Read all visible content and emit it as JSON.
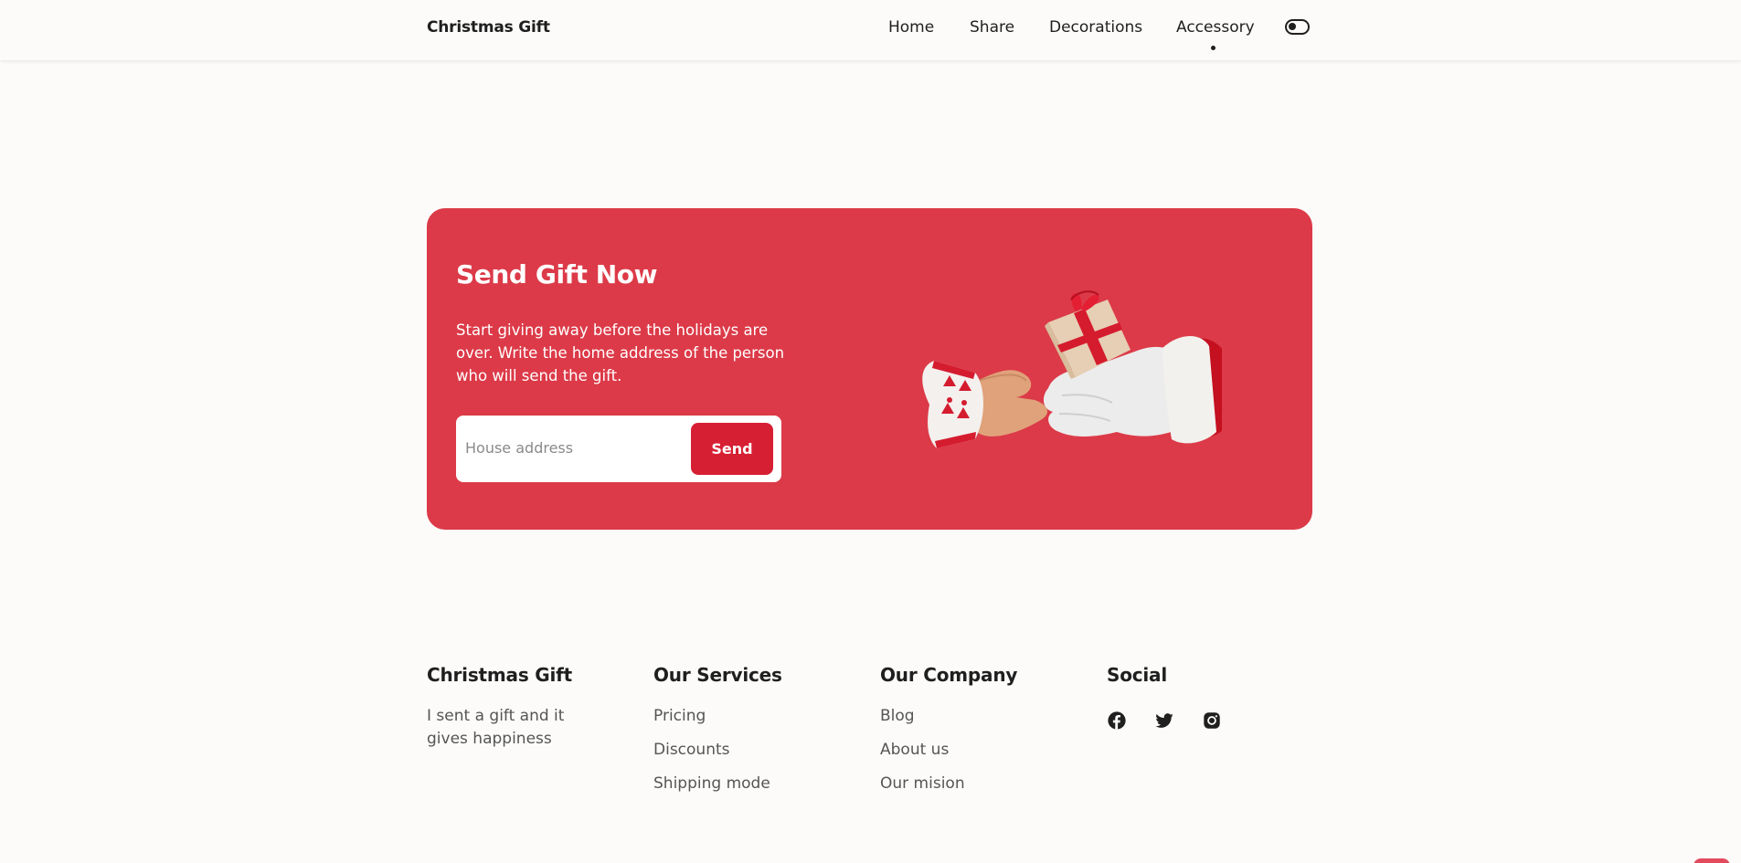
{
  "header": {
    "logo": "Christmas Gift",
    "nav": {
      "home": "Home",
      "share": "Share",
      "decorations": "Decorations",
      "accessory": "Accessory"
    },
    "active_item": "Accessory",
    "theme_toggle_icon": "toggle-icon"
  },
  "banner": {
    "title": "Send Gift Now",
    "text": "Start giving away before the holidays are over. Write the home address of the person who will send the gift.",
    "input_placeholder": "House address",
    "input_value": "",
    "button_label": "Send",
    "illustration_icon": "gift-hands-illustration",
    "background_color": "#dc3a48",
    "button_color": "#d71f33"
  },
  "footer": {
    "brand": {
      "title": "Christmas Gift",
      "description": "I sent a gift and it gives happiness"
    },
    "services": {
      "title": "Our Services",
      "links": [
        "Pricing",
        "Discounts",
        "Shipping mode"
      ]
    },
    "company": {
      "title": "Our Company",
      "links": [
        "Blog",
        "About us",
        "Our mision"
      ]
    },
    "social": {
      "title": "Social",
      "icons": [
        "facebook-icon",
        "twitter-icon",
        "instagram-icon"
      ]
    }
  }
}
